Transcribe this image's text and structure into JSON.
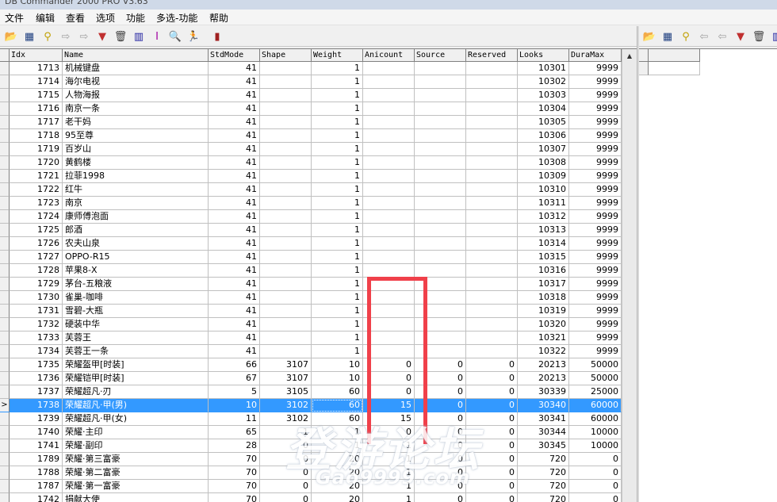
{
  "window": {
    "title": "DB Commander 2000 PRO V3.63"
  },
  "menu": [
    {
      "label": "文件"
    },
    {
      "label": "编辑"
    },
    {
      "label": "查看"
    },
    {
      "label": "选项"
    },
    {
      "label": "功能"
    },
    {
      "label": "多选-功能"
    },
    {
      "label": "帮助"
    }
  ],
  "toolbar_left": [
    {
      "icon": "open-folder-icon",
      "glyph": "📂",
      "color": "#c8a000"
    },
    {
      "icon": "table-icon",
      "glyph": "▦",
      "color": "#204080"
    },
    {
      "icon": "query-icon",
      "glyph": "⚲",
      "color": "#c0a000"
    },
    {
      "icon": "arrow-right-icon",
      "glyph": "⇨",
      "color": "#a0a0a0"
    },
    {
      "icon": "export-icon",
      "glyph": "⇨",
      "color": "#a0a0a0"
    },
    {
      "icon": "filter-icon",
      "glyph": "▼",
      "color": "#c03030"
    },
    {
      "icon": "trash-icon",
      "glyph": "🗑",
      "color": "#404040"
    },
    {
      "icon": "grid-edit-icon",
      "glyph": "▥",
      "color": "#2020a0"
    },
    {
      "icon": "insert-icon",
      "glyph": "I",
      "color": "#a000a0"
    },
    {
      "icon": "search-icon",
      "glyph": "🔍",
      "color": "#008080"
    },
    {
      "icon": "run-icon",
      "glyph": "🏃",
      "color": "#008000"
    },
    {
      "icon": "book-icon",
      "glyph": "▮",
      "color": "#a02020"
    }
  ],
  "toolbar_right": [
    {
      "icon": "open-folder-icon",
      "glyph": "📂",
      "color": "#c8a000"
    },
    {
      "icon": "table-icon",
      "glyph": "▦",
      "color": "#204080"
    },
    {
      "icon": "query-icon",
      "glyph": "⚲",
      "color": "#c0a000"
    },
    {
      "icon": "arrow-left-icon",
      "glyph": "⇦",
      "color": "#a0a0a0"
    },
    {
      "icon": "import-icon",
      "glyph": "⇦",
      "color": "#a0a0a0"
    },
    {
      "icon": "filter-icon",
      "glyph": "▼",
      "color": "#c03030"
    },
    {
      "icon": "trash-icon",
      "glyph": "🗑",
      "color": "#404040"
    },
    {
      "icon": "grid-edit-icon",
      "glyph": "▥",
      "color": "#2020a0"
    }
  ],
  "grid": {
    "columns": [
      "Idx",
      "Name",
      "StdMode",
      "Shape",
      "Weight",
      "Anicount",
      "Source",
      "Reserved",
      "Looks",
      "DuraMax"
    ],
    "selected_marker": ">",
    "rows": [
      [
        "1713",
        "机械键盘",
        "41",
        "",
        "1",
        "",
        "",
        "",
        "10301",
        "9999"
      ],
      [
        "1714",
        "海尔电视",
        "41",
        "",
        "1",
        "",
        "",
        "",
        "10302",
        "9999"
      ],
      [
        "1715",
        "人物海报",
        "41",
        "",
        "1",
        "",
        "",
        "",
        "10303",
        "9999"
      ],
      [
        "1716",
        "南京一条",
        "41",
        "",
        "1",
        "",
        "",
        "",
        "10304",
        "9999"
      ],
      [
        "1717",
        "老干妈",
        "41",
        "",
        "1",
        "",
        "",
        "",
        "10305",
        "9999"
      ],
      [
        "1718",
        "95至尊",
        "41",
        "",
        "1",
        "",
        "",
        "",
        "10306",
        "9999"
      ],
      [
        "1719",
        "百岁山",
        "41",
        "",
        "1",
        "",
        "",
        "",
        "10307",
        "9999"
      ],
      [
        "1720",
        "黄鹤楼",
        "41",
        "",
        "1",
        "",
        "",
        "",
        "10308",
        "9999"
      ],
      [
        "1721",
        "拉菲1998",
        "41",
        "",
        "1",
        "",
        "",
        "",
        "10309",
        "9999"
      ],
      [
        "1722",
        "红牛",
        "41",
        "",
        "1",
        "",
        "",
        "",
        "10310",
        "9999"
      ],
      [
        "1723",
        "南京",
        "41",
        "",
        "1",
        "",
        "",
        "",
        "10311",
        "9999"
      ],
      [
        "1724",
        "康师傅泡面",
        "41",
        "",
        "1",
        "",
        "",
        "",
        "10312",
        "9999"
      ],
      [
        "1725",
        "郎酒",
        "41",
        "",
        "1",
        "",
        "",
        "",
        "10313",
        "9999"
      ],
      [
        "1726",
        "农夫山泉",
        "41",
        "",
        "1",
        "",
        "",
        "",
        "10314",
        "9999"
      ],
      [
        "1727",
        "OPPO-R15",
        "41",
        "",
        "1",
        "",
        "",
        "",
        "10315",
        "9999"
      ],
      [
        "1728",
        "苹果8-X",
        "41",
        "",
        "1",
        "",
        "",
        "",
        "10316",
        "9999"
      ],
      [
        "1729",
        "茅台-五粮液",
        "41",
        "",
        "1",
        "",
        "",
        "",
        "10317",
        "9999"
      ],
      [
        "1730",
        "雀巢-咖啡",
        "41",
        "",
        "1",
        "",
        "",
        "",
        "10318",
        "9999"
      ],
      [
        "1731",
        "雪碧-大瓶",
        "41",
        "",
        "1",
        "",
        "",
        "",
        "10319",
        "9999"
      ],
      [
        "1732",
        "硬装中华",
        "41",
        "",
        "1",
        "",
        "",
        "",
        "10320",
        "9999"
      ],
      [
        "1733",
        "芙蓉王",
        "41",
        "",
        "1",
        "",
        "",
        "",
        "10321",
        "9999"
      ],
      [
        "1734",
        "芙蓉王一条",
        "41",
        "",
        "1",
        "",
        "",
        "",
        "10322",
        "9999"
      ],
      [
        "1735",
        "荣耀盔甲[时装]",
        "66",
        "3107",
        "10",
        "0",
        "0",
        "0",
        "20213",
        "50000"
      ],
      [
        "1736",
        "荣耀铠甲[时装]",
        "67",
        "3107",
        "10",
        "0",
        "0",
        "0",
        "20213",
        "50000"
      ],
      [
        "1737",
        "荣耀超凡·刃",
        "5",
        "3105",
        "60",
        "0",
        "0",
        "0",
        "30339",
        "25000"
      ],
      [
        "1738",
        "荣耀超凡·甲(男)",
        "10",
        "3102",
        "60",
        "15",
        "0",
        "0",
        "30340",
        "60000"
      ],
      [
        "1739",
        "荣耀超凡·甲(女)",
        "11",
        "3102",
        "60",
        "15",
        "0",
        "0",
        "30341",
        "60000"
      ],
      [
        "1740",
        "荣耀·主印",
        "65",
        "1",
        "1",
        "0",
        "0",
        "0",
        "30344",
        "10000"
      ],
      [
        "1741",
        "荣耀·副印",
        "28",
        "0",
        "1",
        "1",
        "0",
        "0",
        "30345",
        "10000"
      ],
      [
        "1789",
        "荣耀·第三富豪",
        "70",
        "0",
        "20",
        "1",
        "0",
        "0",
        "720",
        "0"
      ],
      [
        "1788",
        "荣耀·第二富豪",
        "70",
        "0",
        "20",
        "1",
        "0",
        "0",
        "720",
        "0"
      ],
      [
        "1787",
        "荣耀·第一富豪",
        "70",
        "0",
        "20",
        "1",
        "0",
        "0",
        "720",
        "0"
      ],
      [
        "1742",
        "捐献大使",
        "70",
        "0",
        "20",
        "1",
        "0",
        "0",
        "720",
        "0"
      ]
    ],
    "selected_row": 25
  },
  "watermark": {
    "text": "登游论坛",
    "sub": "Gao9999.com"
  },
  "colors": {
    "selection": "#3399ff",
    "highlight_box": "#f0404a"
  }
}
